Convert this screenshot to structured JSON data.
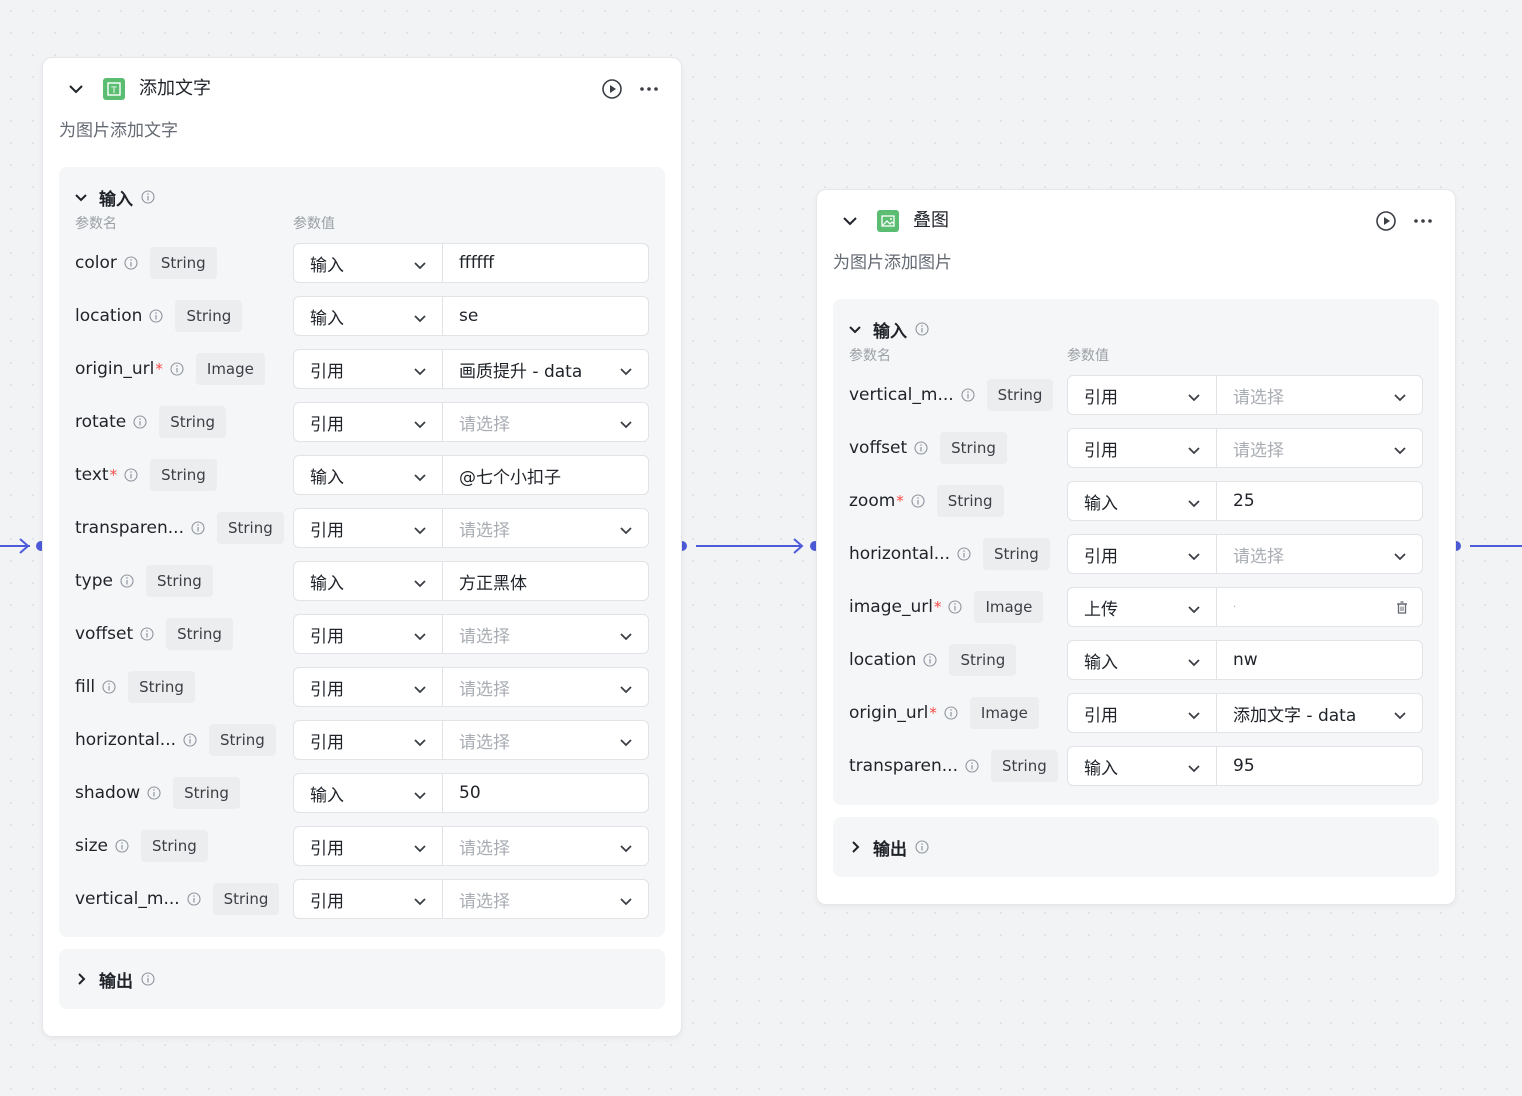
{
  "node1": {
    "title": "添加文字",
    "desc": "为图片添加文字",
    "input_label": "输入",
    "output_label": "输出",
    "col_name": "参数名",
    "col_value": "参数值",
    "params": [
      {
        "name": "color",
        "required": false,
        "type": "String",
        "mode": "输入",
        "value": "ffffff",
        "placeholder": false,
        "select": false
      },
      {
        "name": "location",
        "required": false,
        "type": "String",
        "mode": "输入",
        "value": "se",
        "placeholder": false,
        "select": false
      },
      {
        "name": "origin_url",
        "required": true,
        "type": "Image",
        "mode": "引用",
        "value": "画质提升 - data",
        "placeholder": false,
        "select": true
      },
      {
        "name": "rotate",
        "required": false,
        "type": "String",
        "mode": "引用",
        "value": "请选择",
        "placeholder": true,
        "select": true
      },
      {
        "name": "text",
        "required": true,
        "type": "String",
        "mode": "输入",
        "value": "@七个小扣子",
        "placeholder": false,
        "select": false
      },
      {
        "name": "transparen...",
        "required": false,
        "type": "String",
        "mode": "引用",
        "value": "请选择",
        "placeholder": true,
        "select": true
      },
      {
        "name": "type",
        "required": false,
        "type": "String",
        "mode": "输入",
        "value": "方正黑体",
        "placeholder": false,
        "select": false
      },
      {
        "name": "voffset",
        "required": false,
        "type": "String",
        "mode": "引用",
        "value": "请选择",
        "placeholder": true,
        "select": true
      },
      {
        "name": "fill",
        "required": false,
        "type": "String",
        "mode": "引用",
        "value": "请选择",
        "placeholder": true,
        "select": true
      },
      {
        "name": "horizontal...",
        "required": false,
        "type": "String",
        "mode": "引用",
        "value": "请选择",
        "placeholder": true,
        "select": true
      },
      {
        "name": "shadow",
        "required": false,
        "type": "String",
        "mode": "输入",
        "value": "50",
        "placeholder": false,
        "select": false
      },
      {
        "name": "size",
        "required": false,
        "type": "String",
        "mode": "引用",
        "value": "请选择",
        "placeholder": true,
        "select": true
      },
      {
        "name": "vertical_m...",
        "required": false,
        "type": "String",
        "mode": "引用",
        "value": "请选择",
        "placeholder": true,
        "select": true
      }
    ]
  },
  "node2": {
    "title": "叠图",
    "desc": "为图片添加图片",
    "input_label": "输入",
    "output_label": "输出",
    "col_name": "参数名",
    "col_value": "参数值",
    "params": [
      {
        "name": "vertical_m...",
        "required": false,
        "type": "String",
        "mode": "引用",
        "value": "请选择",
        "placeholder": true,
        "select": true
      },
      {
        "name": "voffset",
        "required": false,
        "type": "String",
        "mode": "引用",
        "value": "请选择",
        "placeholder": true,
        "select": true
      },
      {
        "name": "zoom",
        "required": true,
        "type": "String",
        "mode": "输入",
        "value": "25",
        "placeholder": false,
        "select": false
      },
      {
        "name": "horizontal...",
        "required": false,
        "type": "String",
        "mode": "引用",
        "value": "请选择",
        "placeholder": true,
        "select": true
      },
      {
        "name": "image_url",
        "required": true,
        "type": "Image",
        "mode": "上传",
        "value": "",
        "placeholder": false,
        "select": false,
        "upload": true
      },
      {
        "name": "location",
        "required": false,
        "type": "String",
        "mode": "输入",
        "value": "nw",
        "placeholder": false,
        "select": false
      },
      {
        "name": "origin_url",
        "required": true,
        "type": "Image",
        "mode": "引用",
        "value": "添加文字 - data",
        "placeholder": false,
        "select": true
      },
      {
        "name": "transparen...",
        "required": false,
        "type": "String",
        "mode": "输入",
        "value": "95",
        "placeholder": false,
        "select": false
      }
    ]
  },
  "colors": {
    "port": "#4e5bd8",
    "icon_green": "#5bbd72",
    "required": "#f54a45"
  }
}
